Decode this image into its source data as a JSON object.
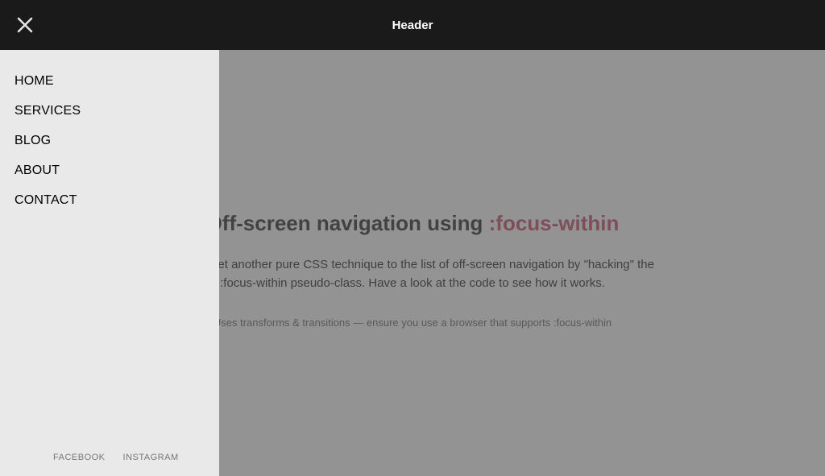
{
  "header": {
    "title": "Header"
  },
  "sidebar": {
    "items": [
      {
        "label": "HOME"
      },
      {
        "label": "SERVICES"
      },
      {
        "label": "BLOG"
      },
      {
        "label": "ABOUT"
      },
      {
        "label": "CONTACT"
      }
    ],
    "social": [
      {
        "label": "FACEBOOK"
      },
      {
        "label": "INSTAGRAM"
      }
    ]
  },
  "content": {
    "heading_prefix": "Off-screen navigation using ",
    "heading_accent": ":focus-within",
    "body": "Adding yet another pure CSS technique to the list of off-screen navigation by \"hacking\" the :focus-within pseudo-class. Have a look at the code to see how it works.",
    "note": "Uses transforms & transitions — ensure you use a browser that supports :focus-within"
  },
  "colors": {
    "header_bg": "#1a1a1a",
    "sidebar_bg": "#e9e9e9",
    "accent": "#c84a6b"
  }
}
